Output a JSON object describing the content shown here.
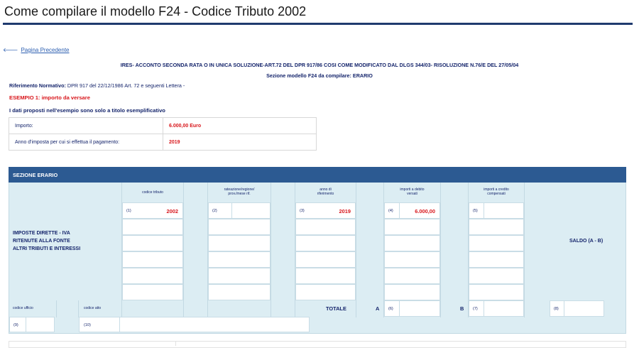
{
  "page": {
    "title": "Come compilare il modello F24 - Codice Tributo 2002"
  },
  "nav": {
    "back_label": "Pagina Precedente"
  },
  "header": {
    "line1": "IRES- ACCONTO SECONDA RATA O IN UNICA SOLUZIONE-ART.72 DEL DPR 917/86 COSI COME MODIFICATO DAL DLGS 344/03- RISOLUZIONE N.76/E DEL 27/05/04",
    "line2": "Sezione modello F24 da compilare: ERARIO"
  },
  "riferimento": {
    "label": "Riferimento Normativo:",
    "value": "DPR  917 del 22/12/1986 Art. 72 e seguenti Lettera -"
  },
  "esempio_label": "ESEMPIO 1: importo da versare",
  "note": "I dati proposti nell'esempio sono solo a titolo esemplificativo",
  "summary": [
    {
      "label": "Importo:",
      "value": "6.000,00 Euro"
    },
    {
      "label": "Anno d'imposta per cui si effettua il pagamento:",
      "value": "2019"
    }
  ],
  "sezione": {
    "title": "SEZIONE ERARIO",
    "left_lines": [
      "IMPOSTE DIRETTE - IVA",
      "RITENUTE ALLA FONTE",
      "ALTRI TRIBUTI E INTERESSI"
    ],
    "columns": [
      {
        "header": "codice tributo",
        "num": "(1)",
        "value": "2002"
      },
      {
        "header": "rateazione/regione/\nprov./mese rif.",
        "num": "(2)",
        "value": ""
      },
      {
        "header": "anno di\nriferimento",
        "num": "(3)",
        "value": "2019"
      },
      {
        "header": "importi a debito\nversati",
        "num": "(4)",
        "value": "6.000,00"
      },
      {
        "header": "importi a credito\ncompensati",
        "num": "(5)",
        "value": ""
      }
    ],
    "saldo_label": "SALDO (A - B)",
    "footer": {
      "codice_ufficio": "codice ufficio",
      "codice_atto": "codice atto",
      "totale": "TOTALE",
      "a": "A",
      "b": "B",
      "n6": "(6)",
      "n7": "(7)",
      "n8": "(8)",
      "n9": "(9)",
      "n10": "(10)"
    }
  }
}
